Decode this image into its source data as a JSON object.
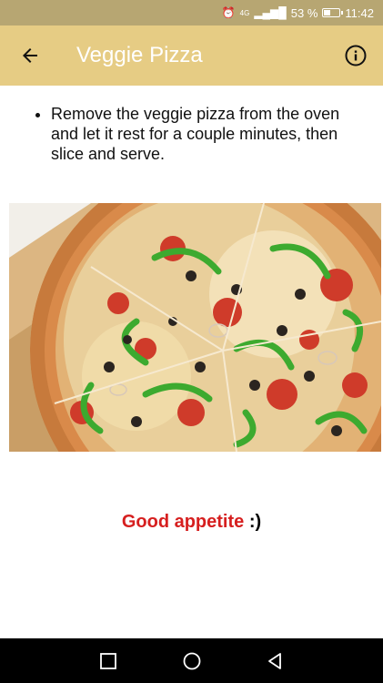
{
  "status_bar": {
    "network": "4G",
    "battery_percent": "53 %",
    "battery_level": 0.53,
    "time": "11:42"
  },
  "app_bar": {
    "title": "Veggie Pizza",
    "back_icon": "arrow-back-icon",
    "info_icon": "info-icon"
  },
  "instructions": [
    "Remove the veggie pizza from the oven and let it rest for a couple minutes, then slice and serve."
  ],
  "closing": {
    "emphasis": "Good appetite",
    "smiley": " :)"
  },
  "nav_bar": {
    "icons": [
      "recent-apps-icon",
      "home-icon",
      "back-icon"
    ]
  },
  "colors": {
    "status_bar": "#b7a672",
    "app_bar": "#e6cc84",
    "closing_red": "#d61f1f"
  }
}
